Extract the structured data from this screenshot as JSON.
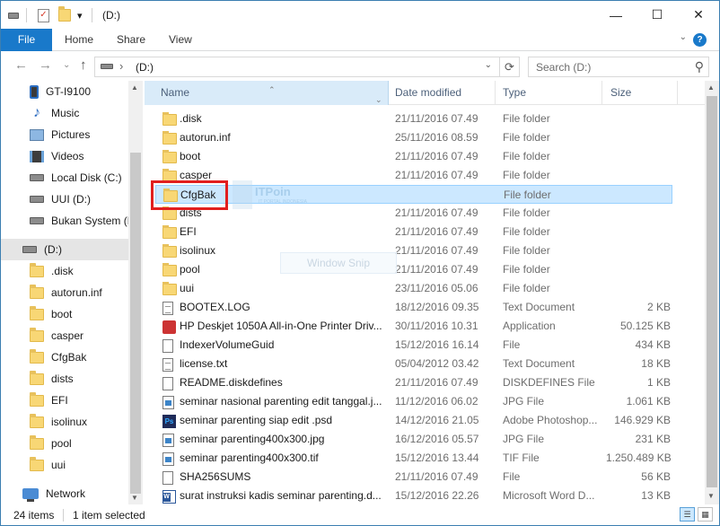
{
  "window": {
    "title": "(D:)",
    "controls": {
      "minimize": "—",
      "maximize": "☐",
      "close": "✕"
    }
  },
  "quick_access": {
    "dropdown": "▾"
  },
  "ribbon": {
    "file": "File",
    "tabs": [
      "Home",
      "Share",
      "View"
    ],
    "collapse": "⌄",
    "help": "?"
  },
  "nav_buttons": {
    "back": "←",
    "forward": "→",
    "recent": "⌄",
    "up": "↑"
  },
  "address": {
    "separator": "›",
    "path": "(D:)",
    "dropdown": "⌄",
    "refresh": "⟳"
  },
  "search": {
    "placeholder": "Search (D:)",
    "icon": "⚲"
  },
  "sidebar": {
    "items": [
      {
        "label": "GT-I9100",
        "icon": "phone-icon"
      },
      {
        "label": "Music",
        "icon": "music-icon"
      },
      {
        "label": "Pictures",
        "icon": "pictures-icon"
      },
      {
        "label": "Videos",
        "icon": "videos-icon"
      },
      {
        "label": "Local Disk (C:)",
        "icon": "drive-icon"
      },
      {
        "label": "UUI (D:)",
        "icon": "drive-icon"
      },
      {
        "label": "Bukan System (E",
        "icon": "drive-icon"
      },
      {
        "label": "(D:)",
        "icon": "drive-icon",
        "selected": true
      },
      {
        "label": ".disk",
        "icon": "folder-icon"
      },
      {
        "label": "autorun.inf",
        "icon": "folder-icon"
      },
      {
        "label": "boot",
        "icon": "folder-icon"
      },
      {
        "label": "casper",
        "icon": "folder-icon"
      },
      {
        "label": "CfgBak",
        "icon": "folder-icon"
      },
      {
        "label": "dists",
        "icon": "folder-icon"
      },
      {
        "label": "EFI",
        "icon": "folder-icon"
      },
      {
        "label": "isolinux",
        "icon": "folder-icon"
      },
      {
        "label": "pool",
        "icon": "folder-icon"
      },
      {
        "label": "uui",
        "icon": "folder-icon"
      },
      {
        "label": "Network",
        "icon": "network-icon"
      }
    ]
  },
  "columns": {
    "name": "Name",
    "date": "Date modified",
    "type": "Type",
    "size": "Size",
    "sort_indicator": "⌃",
    "dropdown": "⌄"
  },
  "files": [
    {
      "name": ".disk",
      "date": "21/11/2016 07.49",
      "type": "File folder",
      "size": "",
      "icon": "folder-icon"
    },
    {
      "name": "autorun.inf",
      "date": "25/11/2016 08.59",
      "type": "File folder",
      "size": "",
      "icon": "folder-icon"
    },
    {
      "name": "boot",
      "date": "21/11/2016 07.49",
      "type": "File folder",
      "size": "",
      "icon": "folder-icon"
    },
    {
      "name": "casper",
      "date": "21/11/2016 07.49",
      "type": "File folder",
      "size": "",
      "icon": "folder-icon"
    },
    {
      "name": "CfgBak",
      "date": "",
      "type": "File folder",
      "size": "",
      "icon": "folder-icon",
      "selected": true
    },
    {
      "name": "dists",
      "date": "21/11/2016 07.49",
      "type": "File folder",
      "size": "",
      "icon": "folder-icon"
    },
    {
      "name": "EFI",
      "date": "21/11/2016 07.49",
      "type": "File folder",
      "size": "",
      "icon": "folder-icon"
    },
    {
      "name": "isolinux",
      "date": "21/11/2016 07.49",
      "type": "File folder",
      "size": "",
      "icon": "folder-icon"
    },
    {
      "name": "pool",
      "date": "21/11/2016 07.49",
      "type": "File folder",
      "size": "",
      "icon": "folder-icon"
    },
    {
      "name": "uui",
      "date": "23/11/2016 05.06",
      "type": "File folder",
      "size": "",
      "icon": "folder-icon"
    },
    {
      "name": "BOOTEX.LOG",
      "date": "18/12/2016 09.35",
      "type": "Text Document",
      "size": "2 KB",
      "icon": "text-document-icon"
    },
    {
      "name": "HP Deskjet 1050A All-in-One Printer Driv...",
      "date": "30/11/2016 10.31",
      "type": "Application",
      "size": "50.125 KB",
      "icon": "application-icon"
    },
    {
      "name": "IndexerVolumeGuid",
      "date": "15/12/2016 16.14",
      "type": "File",
      "size": "434 KB",
      "icon": "file-icon"
    },
    {
      "name": "license.txt",
      "date": "05/04/2012 03.42",
      "type": "Text Document",
      "size": "18 KB",
      "icon": "text-document-icon"
    },
    {
      "name": "README.diskdefines",
      "date": "21/11/2016 07.49",
      "type": "DISKDEFINES File",
      "size": "1 KB",
      "icon": "file-icon"
    },
    {
      "name": "seminar nasional parenting edit tanggal.j...",
      "date": "11/12/2016 06.02",
      "type": "JPG File",
      "size": "1.061 KB",
      "icon": "image-icon"
    },
    {
      "name": "seminar parenting siap edit .psd",
      "date": "14/12/2016 21.05",
      "type": "Adobe Photoshop...",
      "size": "146.929 KB",
      "icon": "photoshop-icon"
    },
    {
      "name": "seminar parenting400x300.jpg",
      "date": "16/12/2016 05.57",
      "type": "JPG File",
      "size": "231 KB",
      "icon": "image-icon"
    },
    {
      "name": "seminar parenting400x300.tif",
      "date": "15/12/2016 13.44",
      "type": "TIF File",
      "size": "1.250.489 KB",
      "icon": "image-icon"
    },
    {
      "name": "SHA256SUMS",
      "date": "21/11/2016 07.49",
      "type": "File",
      "size": "56 KB",
      "icon": "file-icon"
    },
    {
      "name": "surat instruksi kadis seminar parenting.d...",
      "date": "15/12/2016 22.26",
      "type": "Microsoft Word D...",
      "size": "13 KB",
      "icon": "word-document-icon"
    }
  ],
  "watermark": {
    "brand": "ITPoin",
    "tagline": "IT PORTAL INDONESIA",
    "overlay": "Window Snip"
  },
  "status": {
    "count": "24 items",
    "selection": "1 item selected",
    "details_view": "☰",
    "icons_view": "▦"
  },
  "colors": {
    "accent": "#1979ca",
    "selection": "#cce8ff",
    "highlight": "#e11f1f"
  }
}
